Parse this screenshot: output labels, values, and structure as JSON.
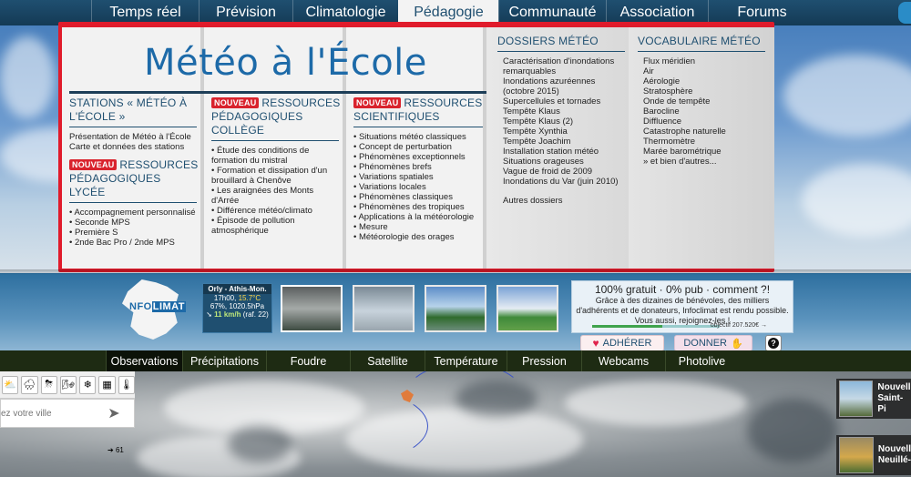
{
  "topnav": {
    "items": [
      "Temps réel",
      "Prévision",
      "Climatologie",
      "Pédagogie",
      "Communauté",
      "Association",
      "Forums"
    ],
    "active_index": 3
  },
  "mega": {
    "logo": "Météo à l'École",
    "col1": {
      "title1": "Stations « Météo à l'École »",
      "links1": [
        "Présentation de Météo à l'École",
        "Carte et données des stations"
      ],
      "badge": "NOUVEAU",
      "title2": "Ressources pédagogiques lycée",
      "links2": [
        "Accompagnement personnalisé",
        "Seconde MPS",
        "Première S",
        "2nde Bac Pro / 2nde MPS"
      ]
    },
    "col2": {
      "badge": "NOUVEAU",
      "title": "Ressources pédagogiques collège",
      "links": [
        "Étude des conditions de formation du mistral",
        "Formation et dissipation d'un brouillard à Chenôve",
        "Les araignées des Monts d'Arrée",
        "Différence météo/climato",
        "Épisode de pollution atmosphérique"
      ]
    },
    "col3": {
      "badge": "NOUVEAU",
      "title": "Ressources scientifiques",
      "links": [
        "Situations météo classiques",
        "Concept de perturbation",
        "Phénomènes exceptionnels",
        "Phénomènes brefs",
        "Variations spatiales",
        "Variations locales",
        "Phénomènes classiques",
        "Phénomènes des tropiques",
        "Applications à la météorologie",
        "Mesure",
        "Météorologie des orages"
      ]
    },
    "col4": {
      "title": "Dossiers météo",
      "links": [
        "Caractérisation d'inondations remarquables",
        "Inondations azuréennes (octobre 2015)",
        "Supercellules et tornades",
        "Tempête Klaus",
        "Tempête Klaus (2)",
        "Tempête Xynthia",
        "Tempête Joachim",
        "Installation station météo",
        "Situations orageuses",
        "Vague de froid de 2009",
        "Inondations du Var (juin 2010)"
      ],
      "more": "Autres dossiers"
    },
    "col5": {
      "title": "Vocabulaire météo",
      "links": [
        "Flux méridien",
        "Air",
        "Aérologie",
        "Stratosphère",
        "Onde de tempête",
        "Barocline",
        "Diffluence",
        "Catastrophe naturelle",
        "Thermomètre",
        "Marée barométrique",
        "» et bien d'autres..."
      ]
    }
  },
  "logo": {
    "part1": "NFO",
    "part2": "LIMAT"
  },
  "station": {
    "name": "Orly - Athis-Mon.",
    "time": "17h00,",
    "temp": "15.7°C",
    "humidity_pressure": "67%, 1020.5hPa",
    "wind": "11 km/h",
    "gust": "(raf. 22)"
  },
  "promo": {
    "headline": "100% gratuit · 0% pub · comment ?!",
    "text1": "Grâce à des dizaines de bénévoles, des milliers",
    "text2": "d'adhérents et de donateurs, Infoclimat est rendu possible.",
    "text3": "Vous aussi, rejoignez-les !",
    "objective": "objectif 207.520€ →",
    "progress": 0.55
  },
  "buttons": {
    "adherer": "ADHÉRER",
    "donner": "DONNER",
    "help": "?"
  },
  "subnav": {
    "items": [
      "Observations",
      "Précipitations",
      "Foudre",
      "Satellite",
      "Température",
      "Pression",
      "Webcams",
      "Photolive"
    ],
    "active_index": 0
  },
  "map": {
    "city_placeholder": "ez votre ville",
    "wind_marker": "61"
  },
  "news": [
    {
      "line1": "Nouvell",
      "line2": "Saint-Pi"
    },
    {
      "line1": "Nouvell",
      "line2": "Neuillé-"
    }
  ]
}
